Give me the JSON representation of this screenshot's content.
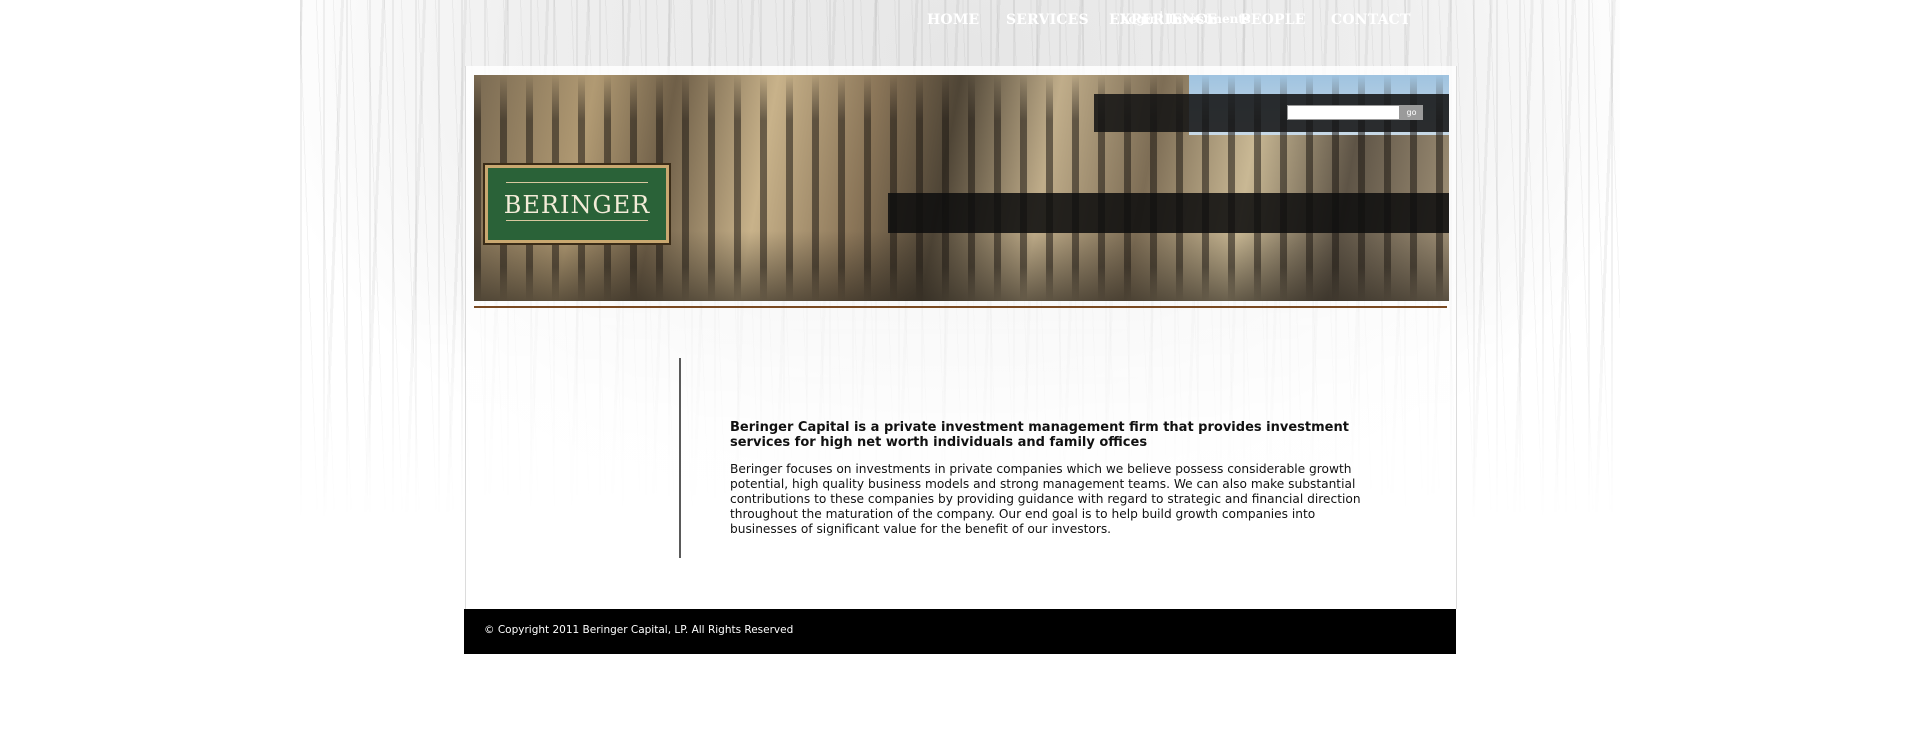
{
  "brand": {
    "logo_text": "BERINGER",
    "logo_green": "#2a6238",
    "logo_border": "#c9a870"
  },
  "utility": {
    "login_label": "Login",
    "separator": "|",
    "investments_label": "Investments",
    "search_value": "",
    "go_label": "go"
  },
  "nav": {
    "items": [
      {
        "label": "HOME"
      },
      {
        "label": "SERVICES"
      },
      {
        "label": "EXPERIENCE"
      },
      {
        "label": "PEOPLE"
      },
      {
        "label": "CONTACT"
      }
    ]
  },
  "main": {
    "headline": "Beringer Capital is a private investment management firm that provides investment services for high net worth individuals and family offices",
    "body": "Beringer focuses on investments in private companies which we believe possess considerable growth potential, high quality business models and strong management teams. We can also make substantial contributions to these companies by providing guidance with regard to strategic and financial direction throughout the maturation of the company. Our end goal is to help build growth companies into businesses of significant value for the benefit of our investors."
  },
  "footer": {
    "copyright": "© Copyright 2011 Beringer Capital, LP. All Rights Reserved"
  },
  "colors": {
    "header_rule": "#7a4a22",
    "footer_bg": "#000000",
    "nav_bg": "#0f0f0f"
  }
}
